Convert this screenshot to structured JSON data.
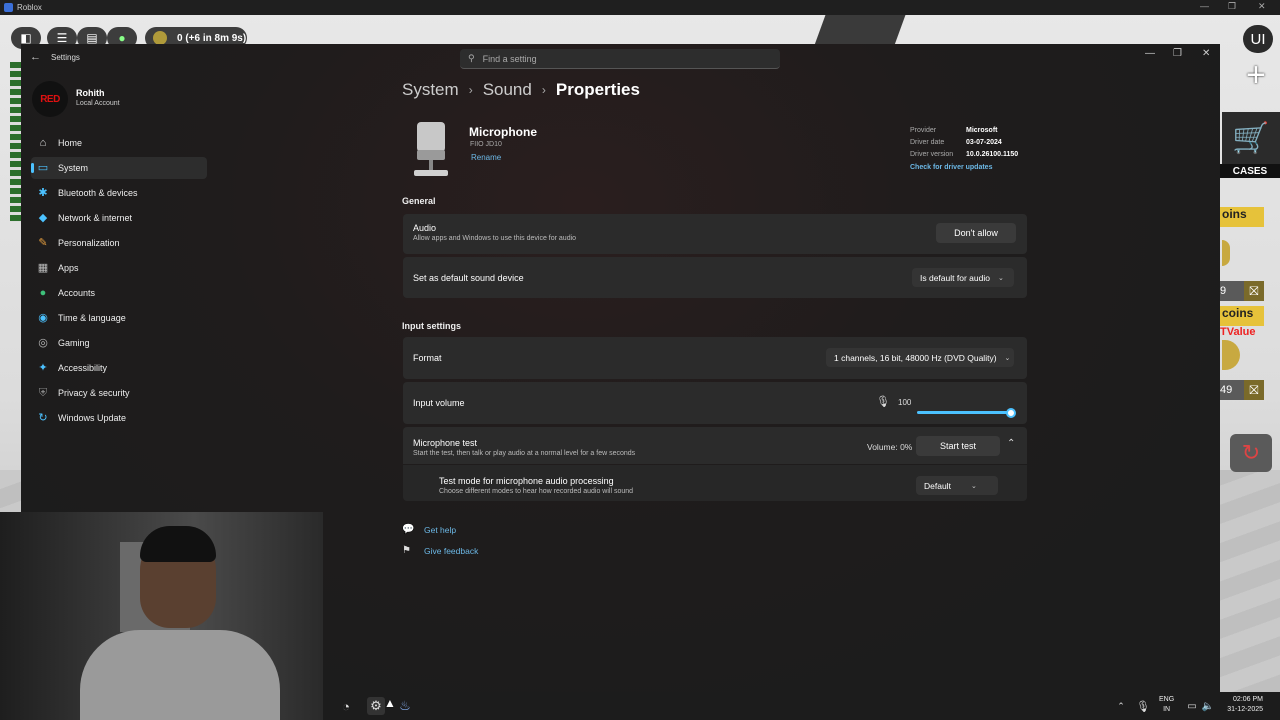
{
  "roblox": {
    "window_title": "Roblox",
    "coins_text": "0 (+6 in 8m 9s)",
    "ui_label": "UI",
    "cases_label": "CASES",
    "coins_label_1": "oins",
    "coins_label_2": "coins",
    "num_1": "9",
    "num_2": "49",
    "red_label": "TValue"
  },
  "settings": {
    "window_title": "Settings",
    "search_placeholder": "Find a setting",
    "profile": {
      "avatar_text": "RED",
      "name": "Rohith",
      "account_type": "Local Account"
    },
    "nav": [
      {
        "label": "Home",
        "icon": "home-icon",
        "glyph": "⌂",
        "color": "#dddddd",
        "active": false
      },
      {
        "label": "System",
        "icon": "system-icon",
        "glyph": "▭",
        "color": "#4cc2ff",
        "active": true
      },
      {
        "label": "Bluetooth & devices",
        "icon": "bluetooth-icon",
        "glyph": "✱",
        "color": "#4cc2ff",
        "active": false
      },
      {
        "label": "Network & internet",
        "icon": "network-icon",
        "glyph": "◆",
        "color": "#4cc2ff",
        "active": false
      },
      {
        "label": "Personalization",
        "icon": "brush-icon",
        "glyph": "✎",
        "color": "#e8a040",
        "active": false
      },
      {
        "label": "Apps",
        "icon": "apps-icon",
        "glyph": "▦",
        "color": "#bbbbbb",
        "active": false
      },
      {
        "label": "Accounts",
        "icon": "accounts-icon",
        "glyph": "●",
        "color": "#3ec07a",
        "active": false
      },
      {
        "label": "Time & language",
        "icon": "globe-icon",
        "glyph": "◉",
        "color": "#4cc2ff",
        "active": false
      },
      {
        "label": "Gaming",
        "icon": "gamepad-icon",
        "glyph": "◎",
        "color": "#bbbbbb",
        "active": false
      },
      {
        "label": "Accessibility",
        "icon": "accessibility-icon",
        "glyph": "✦",
        "color": "#4cc2ff",
        "active": false
      },
      {
        "label": "Privacy & security",
        "icon": "shield-icon",
        "glyph": "⛨",
        "color": "#888888",
        "active": false
      },
      {
        "label": "Windows Update",
        "icon": "update-icon",
        "glyph": "↻",
        "color": "#4cc2ff",
        "active": false
      }
    ],
    "breadcrumb": [
      "System",
      "Sound",
      "Properties"
    ],
    "device": {
      "name": "Microphone",
      "model": "FIIO JD10",
      "rename_label": "Rename"
    },
    "driver": {
      "provider_label": "Provider",
      "provider": "Microsoft",
      "date_label": "Driver date",
      "date": "03-07-2024",
      "version_label": "Driver version",
      "version": "10.0.26100.1150",
      "update_link": "Check for driver updates"
    },
    "general": {
      "heading": "General",
      "audio_title": "Audio",
      "audio_desc": "Allow apps and Windows to use this device for audio",
      "audio_button": "Don't allow",
      "default_title": "Set as default sound device",
      "default_value": "Is default for audio"
    },
    "input": {
      "heading": "Input settings",
      "format_title": "Format",
      "format_value": "1 channels, 16 bit, 48000 Hz (DVD Quality)",
      "volume_title": "Input volume",
      "volume_value": "100",
      "volume_level": 100,
      "test_title": "Microphone test",
      "test_desc": "Start the test, then talk or play audio at a normal level for a few seconds",
      "test_volume": "Volume: 0%",
      "test_button": "Start test",
      "mode_title": "Test mode for microphone audio processing",
      "mode_desc": "Choose different modes to hear how recorded audio will sound",
      "mode_value": "Default"
    },
    "help": {
      "get_help": "Get help",
      "give_feedback": "Give feedback"
    }
  },
  "taskbar": {
    "lang_1": "ENG",
    "lang_2": "IN",
    "time": "02:06 PM",
    "date": "31-12-2025"
  }
}
